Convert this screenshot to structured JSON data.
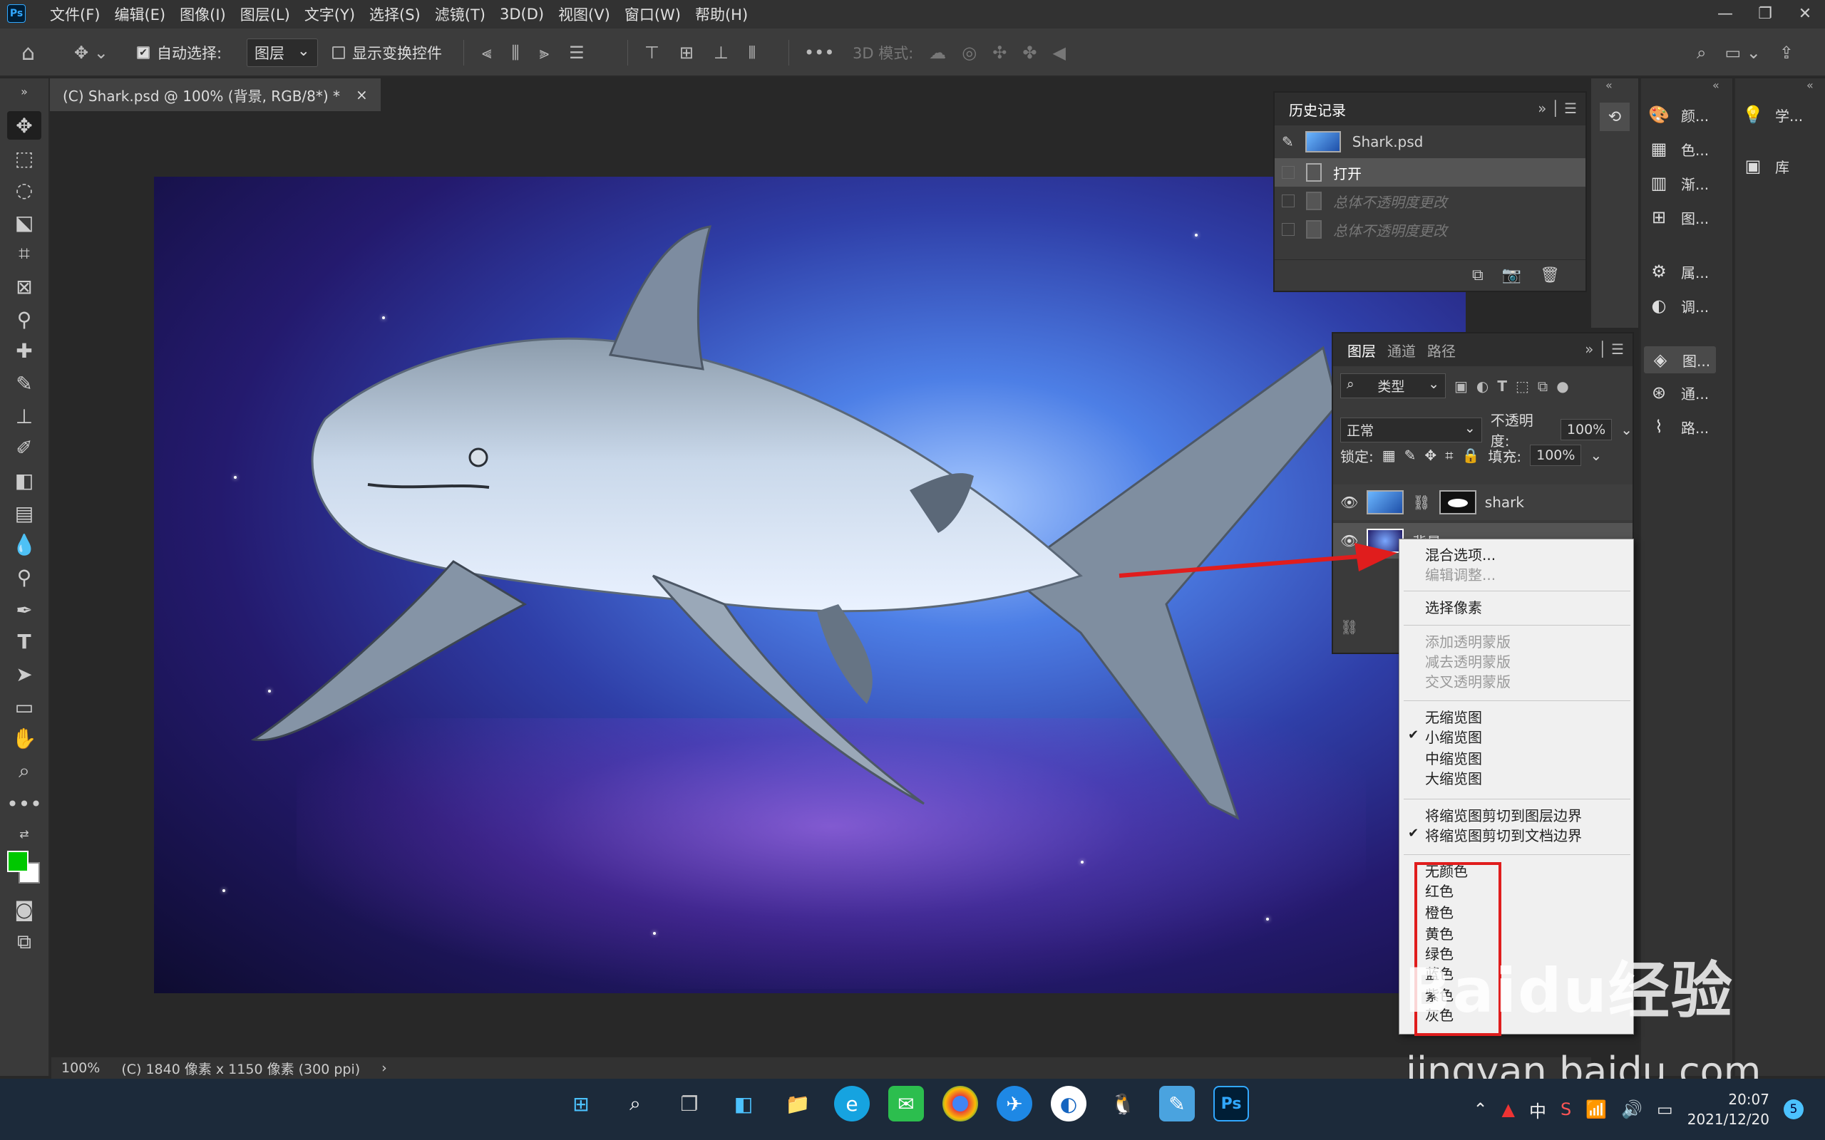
{
  "menubar": {
    "logo": "Ps",
    "items": [
      "文件(F)",
      "编辑(E)",
      "图像(I)",
      "图层(L)",
      "文字(Y)",
      "选择(S)",
      "滤镜(T)",
      "3D(D)",
      "视图(V)",
      "窗口(W)",
      "帮助(H)"
    ]
  },
  "options": {
    "auto_select_label": "自动选择:",
    "auto_select_value": "图层",
    "show_transform_label": "显示变换控件",
    "mode_3d_label": "3D 模式:"
  },
  "document": {
    "tab_title": "(C) Shark.psd @ 100% (背景, RGB/8*) *",
    "close": "×"
  },
  "status": {
    "zoom": "100%",
    "info": "(C) 1840 像素 x 1150 像素 (300 ppi)"
  },
  "history": {
    "title": "历史记录",
    "snapshot": "Shark.psd",
    "rows": [
      {
        "label": "打开",
        "state": "current"
      },
      {
        "label": "总体不透明度更改",
        "state": "undone"
      },
      {
        "label": "总体不透明度更改",
        "state": "undone"
      }
    ]
  },
  "layers": {
    "tabs": [
      "图层",
      "通道",
      "路径"
    ],
    "filter_kind": "类型",
    "blend_mode": "正常",
    "opacity_label": "不透明度:",
    "opacity_value": "100%",
    "lock_label": "锁定:",
    "fill_label": "填充:",
    "fill_value": "100%",
    "layer1_name": "shark",
    "layer2_name": "背景"
  },
  "dock2": {
    "items": [
      "颜...",
      "色...",
      "渐...",
      "图...",
      "属...",
      "调...",
      "图...",
      "通...",
      "路..."
    ]
  },
  "dock3": {
    "items": [
      "学...",
      "库"
    ]
  },
  "context_menu": {
    "blend_options": "混合选项...",
    "edit_adjust": "编辑调整...",
    "select_pixels": "选择像素",
    "add_mask": "添加透明蒙版",
    "sub_mask": "减去透明蒙版",
    "inter_mask": "交叉透明蒙版",
    "no_thumb": "无缩览图",
    "small_thumb": "小缩览图",
    "medium_thumb": "中缩览图",
    "large_thumb": "大缩览图",
    "clip_layer": "将缩览图剪切到图层边界",
    "clip_doc": "将缩览图剪切到文档边界",
    "colors": [
      "无颜色",
      "红色",
      "橙色",
      "黄色",
      "绿色",
      "蓝色",
      "紫色",
      "灰色"
    ]
  },
  "watermark": {
    "logo": "Baidu经验",
    "url": "jingyan.baidu.com"
  },
  "taskbar": {
    "ime": "中",
    "time": "20:07",
    "date": "2021/12/20",
    "notif_count": "5",
    "ps_label": "Ps"
  },
  "colors": {
    "foreground": "#00c800",
    "background": "#ffffff",
    "annotation": "#e01d1d"
  }
}
